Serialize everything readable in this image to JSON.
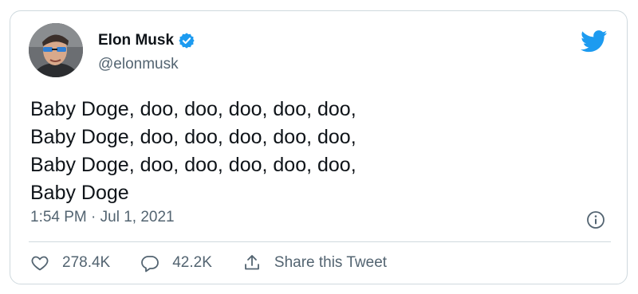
{
  "author": {
    "name": "Elon Musk",
    "handle": "@elonmusk",
    "verified": true
  },
  "tweet": {
    "lines": [
      "Baby Doge, doo, doo, doo, doo, doo,",
      "Baby Doge, doo, doo, doo, doo, doo,",
      "Baby Doge, doo, doo, doo, doo, doo,",
      "Baby Doge"
    ],
    "timestamp": "1:54 PM · Jul 1, 2021"
  },
  "actions": {
    "likes": "278.4K",
    "replies": "42.2K",
    "share_label": "Share this Tweet"
  },
  "icons": {
    "brand": "twitter-bird-icon",
    "verified": "verified-badge-icon",
    "info": "info-icon",
    "like": "heart-icon",
    "reply": "reply-icon",
    "share": "share-icon"
  },
  "colors": {
    "accent": "#1d9bf0",
    "text": "#0f1419",
    "secondary": "#536471",
    "border": "#cfd9de"
  }
}
